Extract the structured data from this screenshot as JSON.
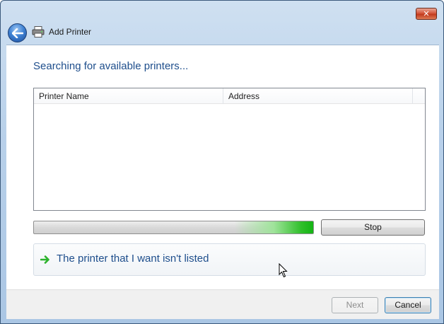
{
  "window": {
    "title": "Add Printer",
    "close_label": "✕"
  },
  "icons": {
    "back": "back-arrow-icon",
    "printer": "printer-icon",
    "link_arrow": "green-arrow-icon",
    "cursor": "mouse-cursor-icon"
  },
  "main": {
    "heading": "Searching for available printers...",
    "table": {
      "columns": [
        "Printer Name",
        "Address"
      ],
      "rows": []
    },
    "progress": {
      "glow_start_fraction": 0.82,
      "glow_color": "#14b414"
    },
    "stop_label": "Stop",
    "not_listed_link": "The printer that I want isn't listed"
  },
  "footer": {
    "next_label": "Next",
    "cancel_label": "Cancel"
  },
  "colors": {
    "heading": "#1e4e8c",
    "link": "#1e4e8c",
    "close_button": "#c23a1d"
  }
}
